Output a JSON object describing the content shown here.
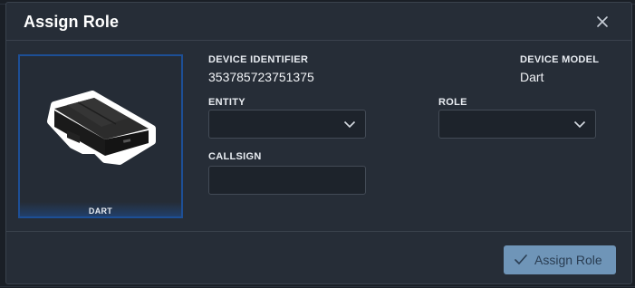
{
  "dialog": {
    "title": "Assign Role",
    "close_icon": "close-icon"
  },
  "device": {
    "image_icon": "gps-tracker-device",
    "name_label": "DART",
    "identifier_label": "DEVICE IDENTIFIER",
    "identifier_value": "353785723751375",
    "model_label": "DEVICE MODEL",
    "model_value": "Dart"
  },
  "form": {
    "entity_label": "ENTITY",
    "entity_value": "",
    "role_label": "ROLE",
    "role_value": "",
    "callsign_label": "CALLSIGN",
    "callsign_value": ""
  },
  "footer": {
    "assign_button_label": "Assign Role",
    "assign_button_icon": "check-icon"
  },
  "colors": {
    "dialog_bg": "#262d37",
    "accent_border": "#1d4f96",
    "button_bg": "#6f95b8"
  }
}
